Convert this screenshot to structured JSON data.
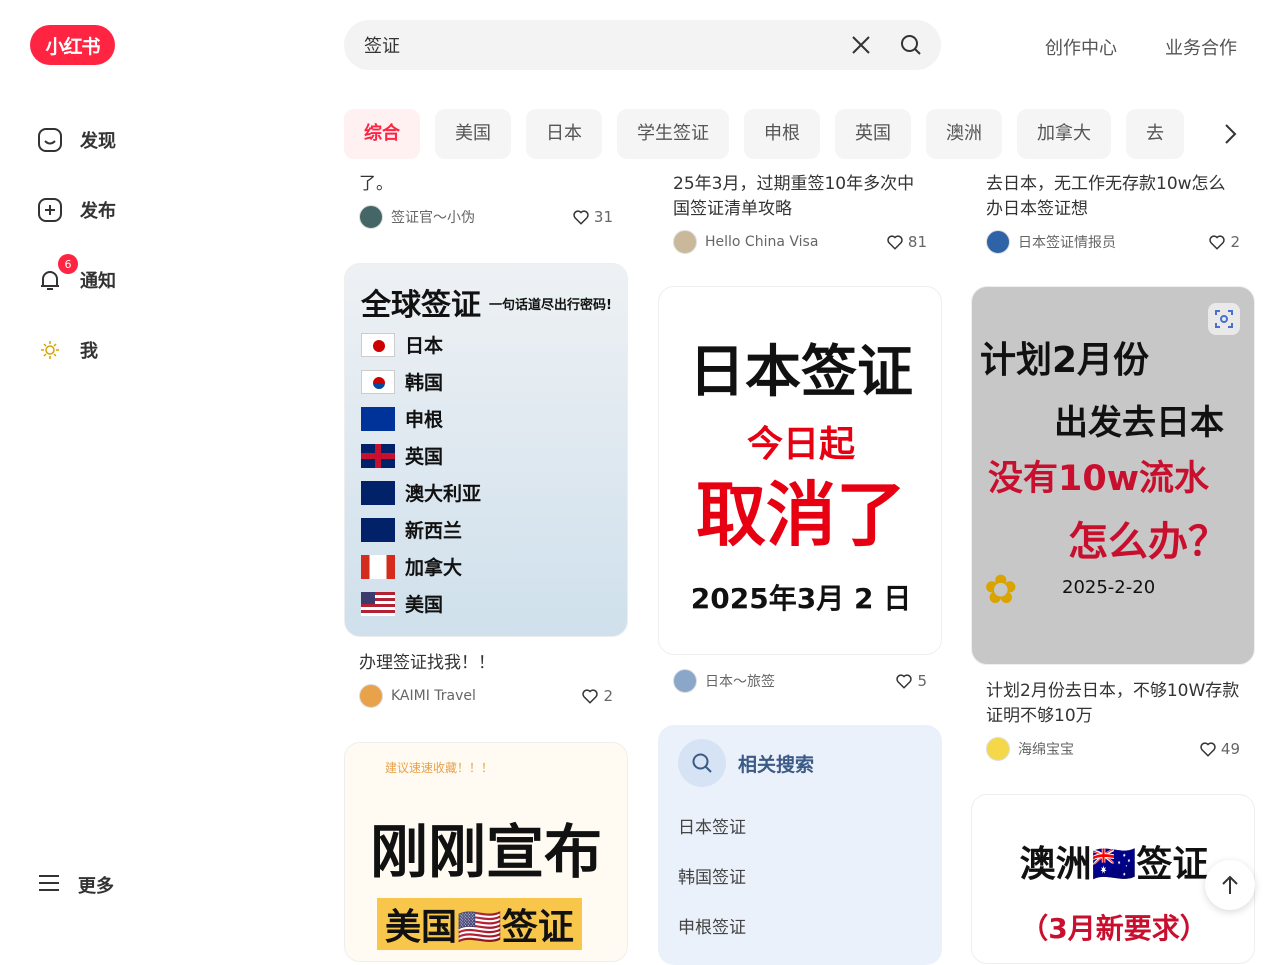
{
  "logo": "小红书",
  "nav": {
    "discover": "发现",
    "publish": "发布",
    "notify": "通知",
    "notify_badge": "6",
    "me": "我",
    "more": "更多"
  },
  "search": {
    "value": "签证",
    "placeholder": ""
  },
  "top_links": {
    "creator": "创作中心",
    "business": "业务合作"
  },
  "chips": [
    "综合",
    "美国",
    "日本",
    "学生签证",
    "申根",
    "英国",
    "澳洲",
    "加拿大",
    "去"
  ],
  "cards": {
    "c1_top": {
      "title": "了。",
      "author": "签证官～小伪",
      "likes": "31"
    },
    "c2_top": {
      "title": "25年3月，过期重签10年多次中国签证清单攻略",
      "author": "Hello China Visa",
      "likes": "81"
    },
    "c3_top": {
      "title": "去日本，无工作无存款10w怎么办日本签证想",
      "author": "日本签证情报员",
      "likes": "2"
    },
    "global": {
      "cover_title": "全球签证",
      "cover_sub": "一句话道尽出行密码!",
      "countries": [
        "日本",
        "韩国",
        "申根",
        "英国",
        "澳大利亚",
        "新西兰",
        "加拿大",
        "美国"
      ],
      "title": "办理签证找我！！",
      "author": "KAIMI Travel",
      "likes": "2"
    },
    "japan_cancel": {
      "line1": "日本签证",
      "line2": "今日起",
      "line3": "取消了",
      "date": "2025年3月 2 日",
      "author": "日本～旅签",
      "likes": "5"
    },
    "plan_feb": {
      "line1": "计划2月份",
      "line2": "出发去日本",
      "line3": "没有10w流水",
      "line4": "怎么办？",
      "date": "2025-2-20",
      "title": "计划2月份去日本，不够10W存款证明不够10万",
      "author": "海绵宝宝",
      "likes": "49"
    },
    "usa": {
      "banner": "建议速速收藏！！！",
      "line1": "刚刚宣布",
      "line2": "美国🇺🇸签证"
    },
    "aus": {
      "line1": "澳洲🇦🇺签证",
      "line2": "（3月新要求）"
    }
  },
  "related": {
    "heading": "相关搜索",
    "items": [
      "日本签证",
      "韩国签证",
      "申根签证"
    ]
  }
}
